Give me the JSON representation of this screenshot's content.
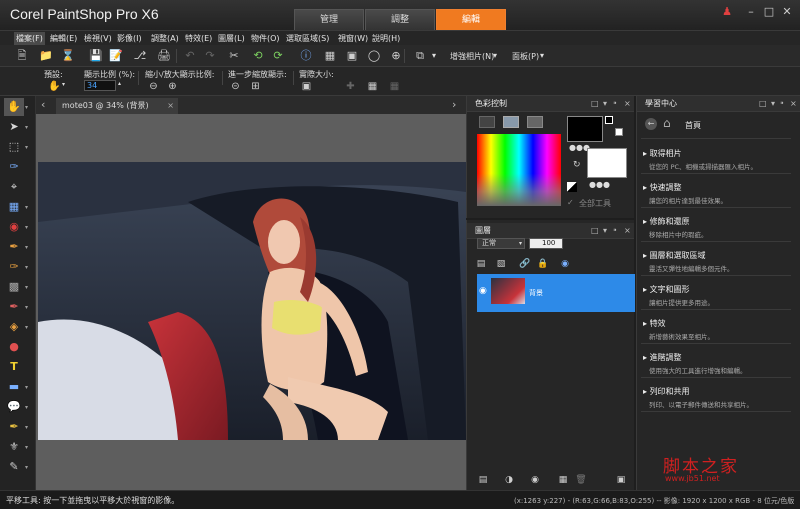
{
  "app": {
    "title": "Corel PaintShop Pro X6"
  },
  "workspace_tabs": [
    {
      "label": "管理",
      "active": false
    },
    {
      "label": "調整",
      "active": false
    },
    {
      "label": "編輯",
      "active": true
    }
  ],
  "menu": [
    "檔案(F)",
    "編輯(E)",
    "檢視(V)",
    "影像(I)",
    "調整(A)",
    "特效(E)",
    "圖層(L)",
    "物件(O)",
    "選取區域(S)",
    "視窗(W)",
    "說明(H)"
  ],
  "toolbar": {
    "enhance_photo": "增強相片(N)",
    "palettes": "面板(P)"
  },
  "options": {
    "presets_label": "預設:",
    "zoom_percent_label": "顯示比例 (%):",
    "zoom_percent_value": "34",
    "zoom_in_out_label": "縮小/放大顯示比例:",
    "zoom_more_label": "進一步縮放顯示:",
    "actual_size_label": "實際大小:"
  },
  "document": {
    "tab_title": "mote03 @  34% (背景)"
  },
  "color_panel": {
    "title": "色彩控制",
    "all_tools_label": "全部工具",
    "foreground_color": "#000000",
    "background_color": "#ffffff"
  },
  "layers_panel": {
    "title": "圖層",
    "blend_mode": "正常",
    "opacity": "100",
    "layer_name": "背景"
  },
  "learning_center": {
    "title": "學習中心",
    "home_label": "首頁",
    "items": [
      {
        "title": "取得相片",
        "desc": "從您的 PC、相機或掃描器匯入相片。"
      },
      {
        "title": "快速調整",
        "desc": "讓您的相片達到最佳效果。"
      },
      {
        "title": "修飾和還原",
        "desc": "移除相片中的瑕疵。"
      },
      {
        "title": "圖層和選取區域",
        "desc": "靈活又彈性地編輯多個元件。"
      },
      {
        "title": "文字和圖形",
        "desc": "讓相片提供更多用途。"
      },
      {
        "title": "特效",
        "desc": "新增藝術效果至相片。"
      },
      {
        "title": "進階調整",
        "desc": "使用強大的工具進行增強和編輯。"
      },
      {
        "title": "列印和共用",
        "desc": "列印、以電子郵件傳送和共享相片。"
      }
    ]
  },
  "status": {
    "text": "平移工具: 按一下並拖曳以平移大於視窗的影像。",
    "info": "(x:1263 y:227) - (R:63,G:66,B:83,O:255) -- 影像: 1920 x 1200 x RGB - 8 位元/色版"
  },
  "watermark": {
    "text_cn": "脚本之家",
    "url": "www.jb51.net"
  },
  "colors": {
    "accent": "#f07a20",
    "layer_selected": "#2d8ae8"
  }
}
